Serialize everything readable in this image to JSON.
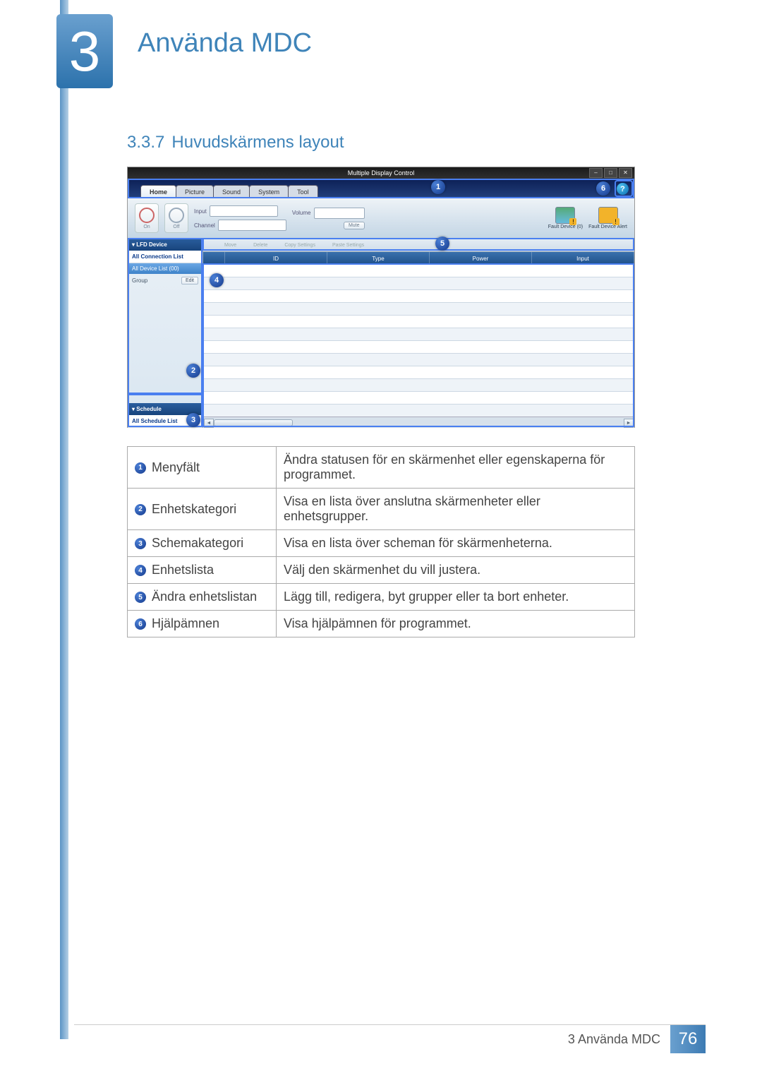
{
  "chapter": {
    "number": "3",
    "title": "Använda MDC"
  },
  "section": {
    "number": "3.3.7",
    "title": "Huvudskärmens layout"
  },
  "screenshot": {
    "window_title": "Multiple Display Control",
    "win_buttons": {
      "min": "–",
      "max": "□",
      "close": "✕"
    },
    "tabs": [
      "Home",
      "Picture",
      "Sound",
      "System",
      "Tool"
    ],
    "help": "?",
    "toolbar": {
      "on": "On",
      "off": "Off",
      "input_label": "Input",
      "channel_label": "Channel",
      "volume_label": "Volume",
      "mute": "Mute",
      "fault_device": "Fault Device (0)",
      "fault_alert": "Fault Device Alert"
    },
    "sidebar": {
      "lfd": "LFD Device",
      "conn": "All Connection List",
      "devlist": "All Device List (00)",
      "group": "Group",
      "edit": "Edit",
      "schedule": "Schedule",
      "sched_list": "All Schedule List"
    },
    "actions": {
      "move": "Move",
      "delete": "Delete",
      "copy": "Copy Settings",
      "paste": "Paste Settings"
    },
    "columns": {
      "blank": "",
      "id": "ID",
      "type": "Type",
      "power": "Power",
      "input": "Input"
    },
    "scroll": {
      "l": "◄",
      "r": "►"
    }
  },
  "callouts": {
    "c1": "1",
    "c2": "2",
    "c3": "3",
    "c4": "4",
    "c5": "5",
    "c6": "6"
  },
  "legend": [
    {
      "n": "1",
      "k": "Menyfält",
      "v": "Ändra statusen för en skärmenhet eller egenskaperna för programmet."
    },
    {
      "n": "2",
      "k": "Enhetskategori",
      "v": "Visa en lista över anslutna skärmenheter eller enhetsgrupper."
    },
    {
      "n": "3",
      "k": "Schemakategori",
      "v": "Visa en lista över scheman för skärmenheterna."
    },
    {
      "n": "4",
      "k": "Enhetslista",
      "v": "Välj den skärmenhet du vill justera."
    },
    {
      "n": "5",
      "k": "Ändra enhetslistan",
      "v": "Lägg till, redigera, byt grupper eller ta bort enheter."
    },
    {
      "n": "6",
      "k": "Hjälpämnen",
      "v": "Visa hjälpämnen för programmet."
    }
  ],
  "footer": {
    "label": "3 Använda MDC",
    "page": "76"
  }
}
